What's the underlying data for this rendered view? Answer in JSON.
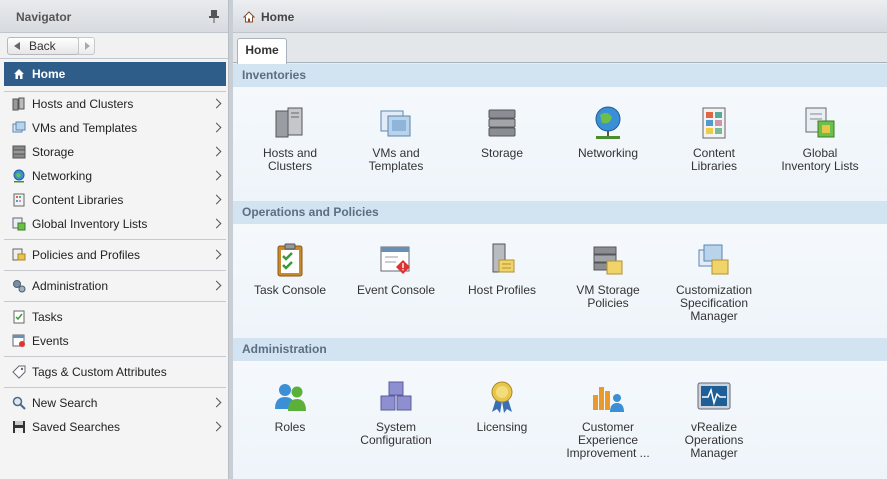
{
  "navigator": {
    "title": "Navigator",
    "back_label": "Back",
    "home_label": "Home",
    "groups": [
      [
        "Hosts and Clusters",
        "VMs and Templates",
        "Storage",
        "Networking",
        "Content Libraries",
        "Global Inventory Lists"
      ],
      [
        "Policies and Profiles"
      ],
      [
        "Administration"
      ],
      [
        "Tasks",
        "Events"
      ],
      [
        "Tags & Custom Attributes"
      ],
      [
        "New Search",
        "Saved Searches"
      ]
    ]
  },
  "main": {
    "title": "Home",
    "tab": "Home",
    "sections": [
      {
        "title": "Inventories",
        "tiles": [
          [
            "Hosts and",
            "Clusters"
          ],
          [
            "VMs and",
            "Templates"
          ],
          [
            "Storage"
          ],
          [
            "Networking"
          ],
          [
            "Content",
            "Libraries"
          ],
          [
            "Global",
            "Inventory Lists"
          ]
        ]
      },
      {
        "title": "Operations and Policies",
        "tiles": [
          [
            "Task Console"
          ],
          [
            "Event Console"
          ],
          [
            "Host Profiles"
          ],
          [
            "VM Storage",
            "Policies"
          ],
          [
            "Customization",
            "Specification",
            "Manager"
          ]
        ]
      },
      {
        "title": "Administration",
        "tiles": [
          [
            "Roles"
          ],
          [
            "System",
            "Configuration"
          ],
          [
            "Licensing"
          ],
          [
            "Customer",
            "Experience",
            "Improvement ..."
          ],
          [
            "vRealize",
            "Operations",
            "Manager"
          ]
        ]
      }
    ]
  },
  "colors": {
    "selected": "#2f5d8a",
    "section_header": "#d2e3f1",
    "section_text": "#5b6f84"
  }
}
